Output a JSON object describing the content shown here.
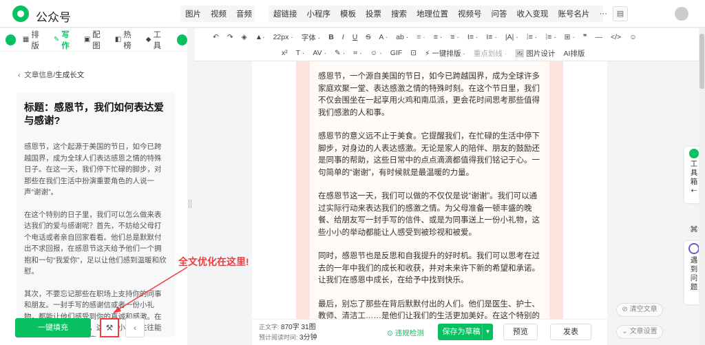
{
  "app": {
    "brand": "公众号"
  },
  "topnav": {
    "group1": [
      "图片",
      "视频",
      "音频"
    ],
    "group2": [
      "超链接",
      "小程序",
      "模板",
      "投票",
      "搜索",
      "地理位置",
      "视频号",
      "问答",
      "收入变现",
      "账号名片",
      "···"
    ]
  },
  "sidebar": {
    "tabs": [
      {
        "icon": "layout-icon",
        "label": "排版"
      },
      {
        "icon": "pen-icon",
        "label": "写作"
      },
      {
        "icon": "image-icon",
        "label": "配图"
      },
      {
        "icon": "hot-icon",
        "label": "热榜"
      },
      {
        "icon": "tools-icon",
        "label": "工具"
      }
    ],
    "crumb_prefix": "文章信息/",
    "crumb_current": "生成长文",
    "title": "标题：感恩节，我们如何表达爱与感谢?",
    "paragraphs": [
      "感恩节，这个起源于美国的节日，如今已跨越国界，成为全球人们表达感恩之情的特殊日子。在这一天，我们停下忙碌的脚步，对那些在我们生活中扮演重要角色的人说一声“谢谢”。",
      "在这个特别的日子里，我们可以怎么做来表达我们的爱与感谢呢？首先，不妨给父母打个电话或者亲自回家看看。他们总是默默付出不求回报，在感恩节这天给予他们一个拥抱和一句“我爱你”，足以让他们感到温暖和欣慰。",
      "其次，不要忘记那些在职场上支持你的同事和朋友。一封手写的感谢信或者一份小礼物，都能让他们感受到你的真诚和感激。在这个快节奏的社会中，这样的小举动往往能拉近人与人之间的距离。"
    ],
    "annotation": "全文优化在这里!",
    "fill_button": "一键填充"
  },
  "toolbar": {
    "row1": [
      "↶",
      "↷",
      "◈",
      "▲·",
      "22px ·",
      "字体 ·",
      "B",
      "I",
      "U",
      "S",
      "A ·",
      "ab ·",
      "≡ ·",
      "≡ ·",
      "≡ ·",
      "I≡ ·",
      "I≡ ·",
      "|A| ·",
      "⁞≡ ·",
      "⁞≡ ·",
      "⊞ ·",
      "❞",
      "—",
      "</>",
      "☺"
    ],
    "row2": [
      "x²",
      "T ·",
      "AV ·",
      "✎ ·",
      "⌗ ·",
      "☺ ·",
      "GIF",
      "⊡",
      "⚡ 一键排版 ·",
      "重点划线 ·",
      "🖼 图片设计",
      "AI排版"
    ]
  },
  "article": [
    "感恩节，一个源自美国的节日，如今已跨越国界，成为全球许多家庭欢聚一堂、表达感激之情的特殊时刻。在这个节日里，我们不仅会围坐在一起享用火鸡和南瓜派，更会花时间思考那些值得我们感激的人和事。",
    "感恩节的意义远不止于美食。它提醒我们，在忙碌的生活中停下脚步，对身边的人表达感激。无论是家人的陪伴、朋友的鼓励还是同事的帮助，这些日常中的点点滴滴都值得我们铭记于心。一句简单的“谢谢”，有时候就是最温暖的力量。",
    "在感恩节这一天，我们可以做的不仅仅是说“谢谢”。我们可以通过实际行动来表达我们的感激之情。为父母准备一顿丰盛的晚餐、给朋友写一封手写的信件、或是为同事送上一份小礼物，这些小小的举动都能让人感受到被珍视和被爱。",
    "同时，感恩节也是反思和自我提升的好时机。我们可以思考在过去的一年中我们的成长和收获，并对未来许下新的希望和承诺。让我们在感恩中成长，在给予中找到快乐。",
    "最后，别忘了那些在背后默默付出的人们。他们是医生、护士、教师、清洁工……是他们让我们的生活更加美好。在这个特别的日子里，让我们也向他们说一声“谢谢”，因为他们的"
  ],
  "right_panel": {
    "toolbox": "工具箱",
    "feedback": "遇到问题",
    "clear_text": "清空文章",
    "text_settings": "文章设置"
  },
  "bottom": {
    "count_label": "正文字",
    "count_value": "870字 31图",
    "read_label": "预计阅读时间:",
    "read_value": "3分钟",
    "violation_check": "违规检测",
    "save_draft": "保存为草稿",
    "preview": "预览",
    "publish": "发表"
  },
  "colors": {
    "accent": "#07c160",
    "annotation": "#f03c3c"
  }
}
